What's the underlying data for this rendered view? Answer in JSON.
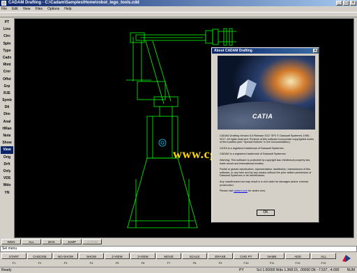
{
  "window": {
    "title": "CADAM Drafting - C:\\Cadam\\Samples\\Home\\robot_lego_tools.cdd"
  },
  "menu": [
    "File",
    "Edit",
    "View",
    "Files",
    "Options",
    "Help"
  ],
  "left_panel": [
    "PT",
    "Line",
    "Circ",
    "Spln",
    "Type",
    "Cadx",
    "Rlmt",
    "Crnr",
    "Offst",
    "Grp",
    "RJE",
    "Symb",
    "Dtl",
    "Dim",
    "Anal",
    "HRan",
    "Note",
    "Show",
    "View",
    "Orig",
    "Drft",
    "Ovly",
    "VDS",
    "Wdo",
    "YN"
  ],
  "left_panel_selected": "View",
  "tabs": [
    "WDO",
    "ALL",
    "BOX",
    "JUMP",
    "ACTIVE"
  ],
  "command_line": "Sel menu",
  "function_keys": [
    "START",
    "CHOOSE",
    "NO-SHOW",
    "SHOW",
    "2-VIEW",
    "3-VIEW",
    "MOVE",
    "SCALE",
    "ERASE",
    "CHG PY",
    "NAME",
    "ADD",
    "ALL"
  ],
  "fn_labels": [
    "F1",
    "F2",
    "F3",
    "F4",
    "F5",
    "F6",
    "F7",
    "F8",
    "F9",
    "F10",
    "F11",
    "F12",
    "F12"
  ],
  "status": {
    "ready": "Ready",
    "py": "PY",
    "coords": "Scl 1.00000  Wdo 1.368:15, .00000  Dlt: -7.537, -4.690",
    "num": "NUM"
  },
  "watermark": "www.cg-ku.com",
  "about": {
    "title": "About CADAM Drafting",
    "logo_text": "CATIA",
    "banner_copy": "© Dassault Systèmes\nCATIA V5 Release 2017 SP2 © Dassault Systèmes",
    "paragraphs": [
      "CADAM Drafting Version 5-6 Release 2017 SP2 © Dassault Systemes 1996 - 2017. All rights reserved. Portions of this software incorporate copyrighted works of third parties (see \"Special Notices\" in the Documentation).",
      "CATIA is a registered trademark of Dassault Systemes.",
      "CADAM is a registered trademark of Dassault Systemes.",
      "Warning: This software is protected by copyright law, intellectual property law, trade secret and international treaties.",
      "Partial or global reproduction, representation, distribution, transmission of this software, in any form and by any means without the prior written permission of Dassault Systemes or its beneficiaries.",
      "Any unauthorized act may result in a civil claim for damages and/or criminal prosecution."
    ],
    "visit_prefix": "Please visit",
    "visit_link": "cadam.com",
    "visit_suffix": "for what's new.",
    "ok_label": "OK"
  },
  "colors": {
    "drawing": "#00ff00",
    "accent": "#00ccff",
    "watermark": "#ffd900"
  }
}
